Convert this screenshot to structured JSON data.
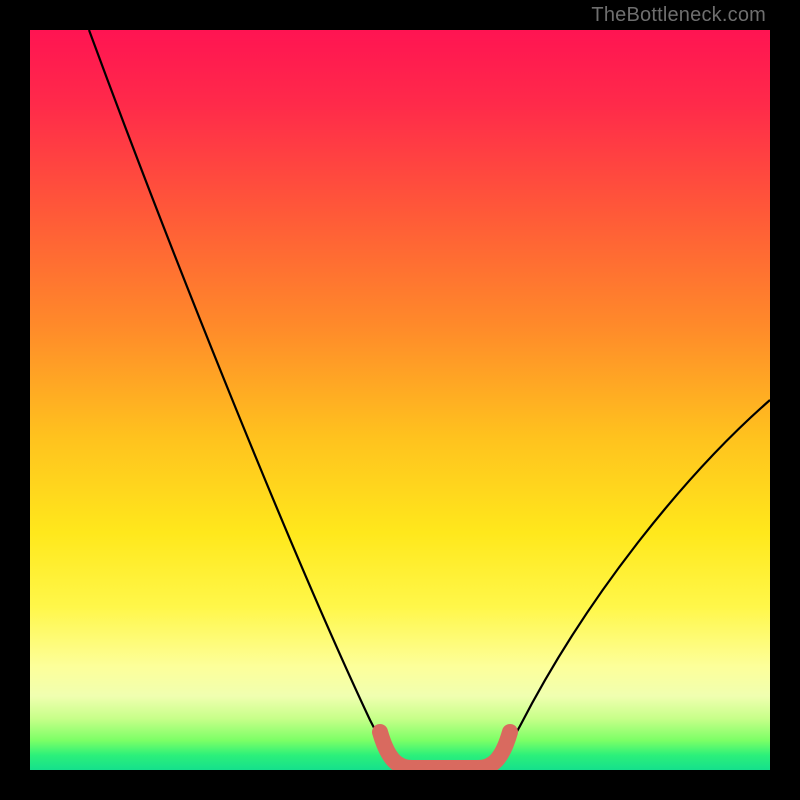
{
  "watermark": "TheBottleneck.com",
  "colors": {
    "background": "#000000",
    "gradient_top": "#ff1452",
    "gradient_bottom": "#15e08c",
    "curve": "#000000",
    "valley_marker": "#d96a5f"
  },
  "chart_data": {
    "type": "line",
    "title": "",
    "xlabel": "",
    "ylabel": "",
    "xlim": [
      0,
      100
    ],
    "ylim": [
      0,
      100
    ],
    "grid": false,
    "series": [
      {
        "name": "bottleneck-curve",
        "x": [
          8,
          12,
          16,
          20,
          24,
          28,
          32,
          36,
          40,
          44,
          48,
          50,
          52,
          54,
          56,
          58,
          60,
          62,
          66,
          72,
          78,
          84,
          90,
          96,
          100
        ],
        "values": [
          100,
          91,
          82,
          73,
          64,
          55,
          46,
          37,
          28,
          19,
          10,
          5,
          2,
          0,
          0,
          0,
          0,
          2,
          7,
          14,
          22,
          30,
          38,
          46,
          52
        ]
      }
    ],
    "valley_marker": {
      "x_start": 50,
      "x_end": 62,
      "y": 0
    }
  }
}
